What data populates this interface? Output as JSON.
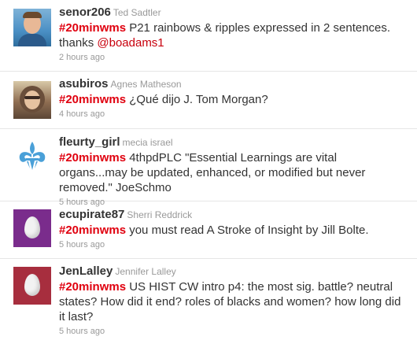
{
  "tweets": [
    {
      "screen_name": "senor206",
      "full_name": "Ted Sadtler",
      "hashtag": "#20minwms",
      "text": " P21 rainbows & ripples expressed in 2 sentences. thanks ",
      "mention": "@boadams1",
      "time": "2 hours ago",
      "avatar_icon": "profile-photo"
    },
    {
      "screen_name": "asubiros",
      "full_name": "Agnes Matheson",
      "hashtag": "#20minwms",
      "text": " ¿Qué dijo J. Tom Morgan?",
      "time": "4 hours ago",
      "avatar_icon": "profile-photo"
    },
    {
      "screen_name": "fleurty_girl",
      "full_name": "mecia israel",
      "hashtag": "#20minwms",
      "text": " 4thpdPLC \"Essential Learnings are vital organs...may be updated, enhanced, or modified but never removed.\" JoeSchmo",
      "time": "5 hours ago",
      "avatar_icon": "fleur-de-lis-logo"
    },
    {
      "screen_name": "ecupirate87",
      "full_name": "Sherri Reddrick",
      "hashtag": "#20minwms",
      "text": " you must read A Stroke of Insight by Jill Bolte.",
      "time": "5 hours ago",
      "avatar_icon": "default-egg",
      "avatar_color": "#7a2c8c"
    },
    {
      "screen_name": "JenLalley",
      "full_name": "Jennifer Lalley",
      "hashtag": "#20minwms",
      "text": " US HIST CW intro p4: the most sig. battle? neutral states? How did it end? roles of blacks and women? how long did it last?",
      "time": "5 hours ago",
      "avatar_icon": "default-egg",
      "avatar_color": "#a72e3e"
    }
  ],
  "colors": {
    "hashtag": "#e0000f",
    "meta": "#999999",
    "text": "#333333",
    "divider": "#e6e6e6"
  }
}
